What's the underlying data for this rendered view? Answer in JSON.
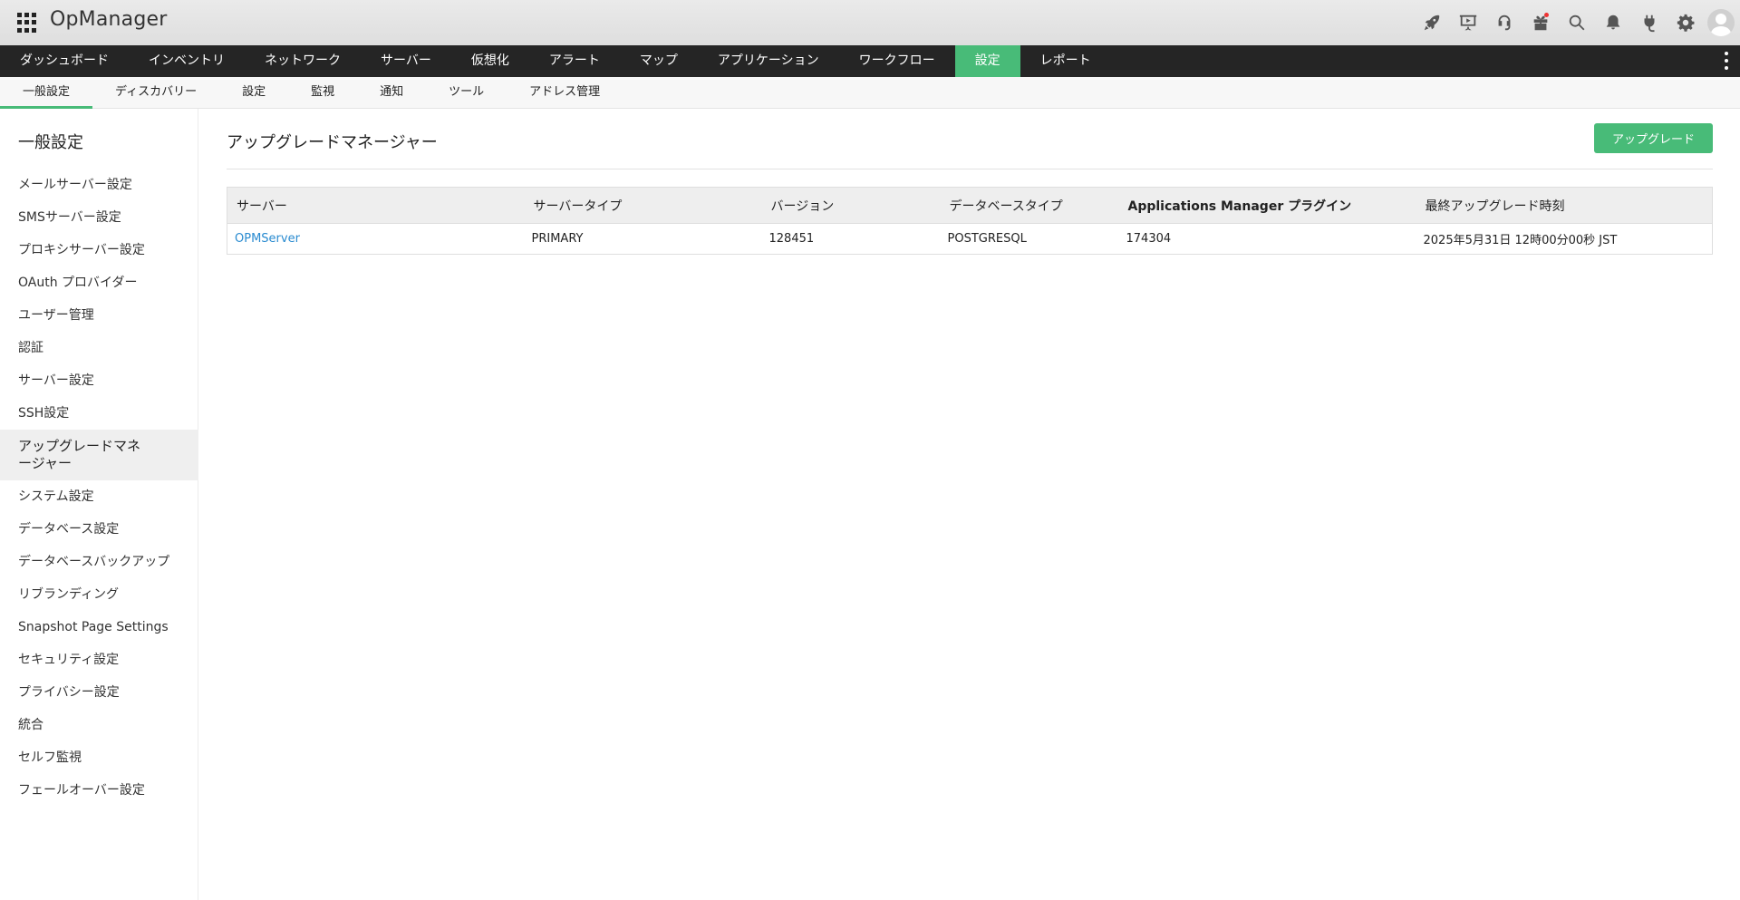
{
  "app": {
    "title": "OpManager",
    "header_icons": [
      "rocket-icon",
      "presentation-icon",
      "headset-icon",
      "gift-icon",
      "search-icon",
      "bell-icon",
      "plug-icon",
      "gear-icon",
      "user-avatar-icon"
    ],
    "accent_color": "#48bb78",
    "nav_bg": "#252525"
  },
  "main_nav": {
    "items": [
      {
        "label": "ダッシュボード"
      },
      {
        "label": "インベントリ"
      },
      {
        "label": "ネットワーク"
      },
      {
        "label": "サーバー"
      },
      {
        "label": "仮想化"
      },
      {
        "label": "アラート"
      },
      {
        "label": "マップ"
      },
      {
        "label": "アプリケーション"
      },
      {
        "label": "ワークフロー"
      },
      {
        "label": "設定"
      },
      {
        "label": "レポート"
      }
    ],
    "active": "設定"
  },
  "sub_nav": {
    "items": [
      {
        "label": "一般設定"
      },
      {
        "label": "ディスカバリー"
      },
      {
        "label": "設定"
      },
      {
        "label": "監視"
      },
      {
        "label": "通知"
      },
      {
        "label": "ツール"
      },
      {
        "label": "アドレス管理"
      }
    ],
    "active": "一般設定"
  },
  "sidebar": {
    "title": "一般設定",
    "items": [
      {
        "label": "メールサーバー設定"
      },
      {
        "label": "SMSサーバー設定"
      },
      {
        "label": "プロキシサーバー設定"
      },
      {
        "label": "OAuth プロバイダー"
      },
      {
        "label": "ユーザー管理"
      },
      {
        "label": "認証"
      },
      {
        "label": "サーバー設定"
      },
      {
        "label": "SSH設定"
      },
      {
        "label": "アップグレードマネージャー"
      },
      {
        "label": "システム設定"
      },
      {
        "label": "データベース設定"
      },
      {
        "label": "データベースバックアップ"
      },
      {
        "label": "リブランディング"
      },
      {
        "label": "Snapshot Page Settings"
      },
      {
        "label": "セキュリティ設定"
      },
      {
        "label": "プライバシー設定"
      },
      {
        "label": "統合"
      },
      {
        "label": "セルフ監視"
      },
      {
        "label": "フェールオーバー設定"
      }
    ],
    "active": "アップグレードマネージャー"
  },
  "main": {
    "title": "アップグレードマネージャー",
    "upgrade_button": "アップグレード",
    "table": {
      "headers": [
        "サーバー",
        "サーバータイプ",
        "バージョン",
        "データベースタイプ",
        "Applications Manager プラグイン",
        "最終アップグレード時刻"
      ],
      "rows": [
        {
          "server": "OPMServer",
          "server_type": "PRIMARY",
          "version": "128451",
          "db_type": "POSTGRESQL",
          "apm_plugin": "174304",
          "last_upgrade": "2025年5月31日 12時00分00秒 JST"
        }
      ]
    }
  }
}
